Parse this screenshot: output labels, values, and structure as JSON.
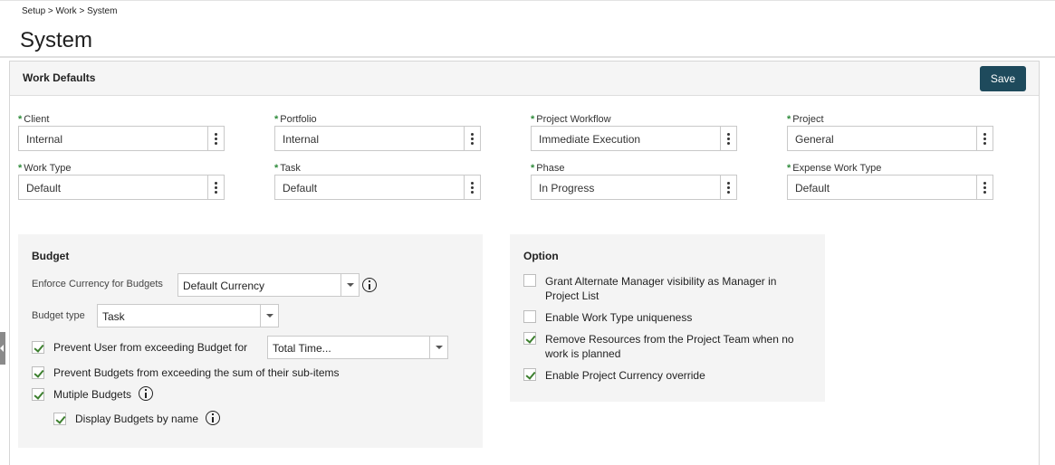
{
  "breadcrumb": "Setup > Work > System",
  "page_title": "System",
  "panel": {
    "title": "Work Defaults",
    "save_label": "Save"
  },
  "fields": [
    {
      "label": "Client",
      "value": "Internal"
    },
    {
      "label": "Portfolio",
      "value": "Internal"
    },
    {
      "label": "Project Workflow",
      "value": "Immediate Execution"
    },
    {
      "label": "Project",
      "value": "General"
    },
    {
      "label": "Work Type",
      "value": "Default"
    },
    {
      "label": "Task",
      "value": "Default"
    },
    {
      "label": "Phase",
      "value": "In Progress"
    },
    {
      "label": "Expense Work Type",
      "value": "Default"
    }
  ],
  "required_mark": "*",
  "budget": {
    "title": "Budget",
    "enforce_currency_label": "Enforce Currency for Budgets",
    "enforce_currency_value": "Default Currency",
    "budget_type_label": "Budget type",
    "budget_type_value": "Task",
    "prevent_user_label": "Prevent User from exceeding Budget for",
    "prevent_user_value": "Total Time...",
    "prevent_user_checked": true,
    "prevent_budgets_label": "Prevent Budgets from exceeding the sum of their sub-items",
    "prevent_budgets_checked": true,
    "multiple_budgets_label": "Mutiple Budgets",
    "multiple_budgets_checked": true,
    "display_by_name_label": "Display Budgets by name",
    "display_by_name_checked": true
  },
  "option": {
    "title": "Option",
    "items": [
      {
        "label_line1": "Grant Alternate Manager visibility as Manager in",
        "label_line2": "Project List",
        "checked": false
      },
      {
        "label_line1": "Enable Work Type uniqueness",
        "label_line2": "",
        "checked": false
      },
      {
        "label_line1": "Remove Resources from the Project Team when no",
        "label_line2": "work is planned",
        "checked": true
      },
      {
        "label_line1": "Enable Project Currency override",
        "label_line2": "",
        "checked": true
      }
    ]
  },
  "colors": {
    "save_button": "#1e4a5c",
    "required": "#2e8b3a",
    "check": "#3c7f2e"
  }
}
